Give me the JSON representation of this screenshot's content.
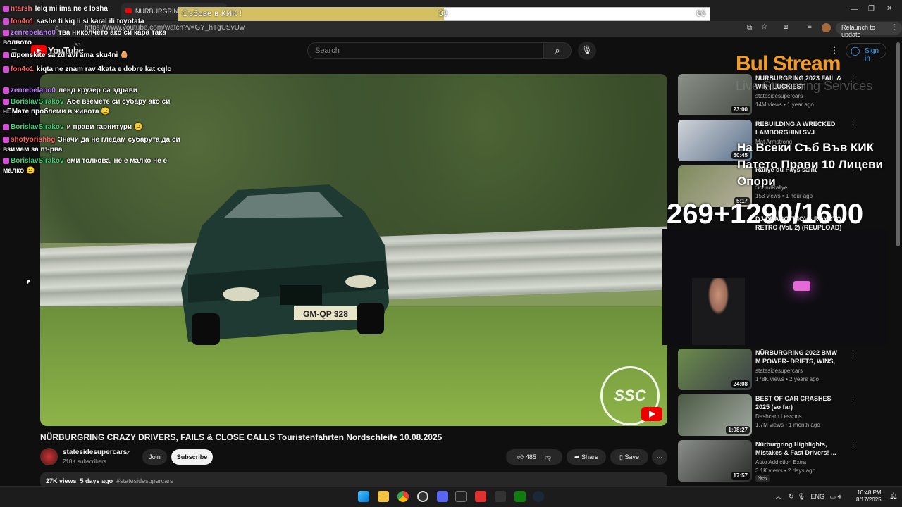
{
  "browser": {
    "tab_title": "NÜRBURGRING CRAZY DRIVERS...",
    "url": "https://www.youtube.com/watch?v=GY_hTgUSvUw",
    "relaunch_label": "Relaunch to update"
  },
  "youtube": {
    "logo_text": "YouTube",
    "logo_region": "BG",
    "search_placeholder": "Search",
    "signin_label": "Sign in"
  },
  "video": {
    "title": "NÜRBURGRING CRAZY DRIVERS, FAILS & CLOSE CALLS Touristenfahrten Nordschleife 10.08.2025",
    "channel": "statesidesupercars",
    "subscribers": "218K subscribers",
    "join_label": "Join",
    "subscribe_label": "Subscribe",
    "likes": "485",
    "share_label": "Share",
    "save_label": "Save",
    "views": "27K views",
    "age": "5 days ago",
    "hashtag": "#statesidesupercars",
    "plate": "GM-QP 328",
    "watermark": "SSC"
  },
  "recommendations": [
    {
      "title": "NÜRBURGRING 2023 FAIL & WIN | LUCKIEST DRIVERS,...",
      "channel": "statesidesupercars",
      "meta": "14M views • 1 year ago",
      "duration": "23:00",
      "new": "",
      "color_a": "#8a8f88",
      "color_b": "#4a5048"
    },
    {
      "title": "REBUILDING A WRECKED LAMBORGHINI SVJ",
      "channel": "Mat Armstrong",
      "meta": "",
      "duration": "50:45",
      "new": "",
      "color_a": "#d0d4d8",
      "color_b": "#5a6f8a"
    },
    {
      "title": "Rallye du Pays saint",
      "channel": "SoundRallye",
      "meta": "153 views • 1 hour ago",
      "duration": "5:17",
      "new": "",
      "color_a": "#7c8a5a",
      "color_b": "#b8b0a0"
    },
    {
      "title": "NÜRBURGRING 2022 BMW M POWER- DRIFTS, WINS, E30, ...",
      "channel": "statesidesupercars",
      "meta": "178K views • 2 years ago",
      "duration": "24:08",
      "new": "",
      "color_a": "#6c8c4c",
      "color_b": "#3c4048"
    },
    {
      "title": "BEST OF CAR CRASHES 2025 (so far)",
      "channel": "Dashcam Lessons",
      "meta": "1.7M views • 1 month ago",
      "duration": "1:08:27",
      "new": "",
      "color_a": "#4c5a44",
      "color_b": "#a0a8a0"
    },
    {
      "title": "Nürburgring Highlights, Mistakes & Fast Drivers! ...",
      "channel": "Auto Addiction Extra",
      "meta": "3.1K views • 2 days ago",
      "duration": "17:57",
      "new": "New",
      "color_a": "#8a8e8a",
      "color_b": "#2a2c2a"
    }
  ],
  "stream_overlay": {
    "goal_label": "Събове в КИК !",
    "goal_current": "33",
    "goal_target": "66",
    "goal_progress": 0.5,
    "brand": "Bul Stream",
    "brand_sub": "Live Streaming Services",
    "promo": "На Всеки Съб Във КИК Патето Прави 10 Лицеви Опори",
    "counter": "269+1290/1600",
    "rec4_overlay": "DJ DRAGOTINOV - ROYOTO RETRO (Vol. 2) (REUPLOAD)"
  },
  "chat": [
    {
      "user": "ntarsh",
      "text": "lelq mi ima ne e losha",
      "color": "#ff6b6b"
    },
    {
      "user": "fon4o1",
      "text": "sashe ti kiq li si karal ili toyotata",
      "color": "#ff5f5f"
    },
    {
      "user": "zenrebelano0",
      "text": "тва николчето ако си кара така волвото",
      "color": "#c080ff"
    },
    {
      "user": "",
      "text": "шponskite sa zdravi ama sku4ni 🥚",
      "color": "#ffffff"
    },
    {
      "user": "fon4o1",
      "text": "kiqta ne znam rav 4kata e dobre kat cqlo",
      "color": "#ff5f5f"
    },
    {
      "user": "zenrebelano0",
      "text": "ленд крузер са здрави",
      "color": "#c080ff"
    },
    {
      "user": "BorislavSirakov",
      "text": "Абе вземете си субару ако си нЕМате проблеми в живота 😐",
      "color": "#3cd67a"
    },
    {
      "user": "BorislavSirakov",
      "text": "и прави гарнитури 😐",
      "color": "#3cd67a"
    },
    {
      "user": "shofyorishbg",
      "text": "Значи да не гледам субарута да си взимам за първа",
      "color": "#ff6060"
    },
    {
      "user": "BorislavSirakov",
      "text": "еми толкова, не е малко не е малко 😐",
      "color": "#3cd67a"
    }
  ],
  "system": {
    "lang": "ENG",
    "time": "10:48 PM",
    "date": "8/17/2025"
  }
}
